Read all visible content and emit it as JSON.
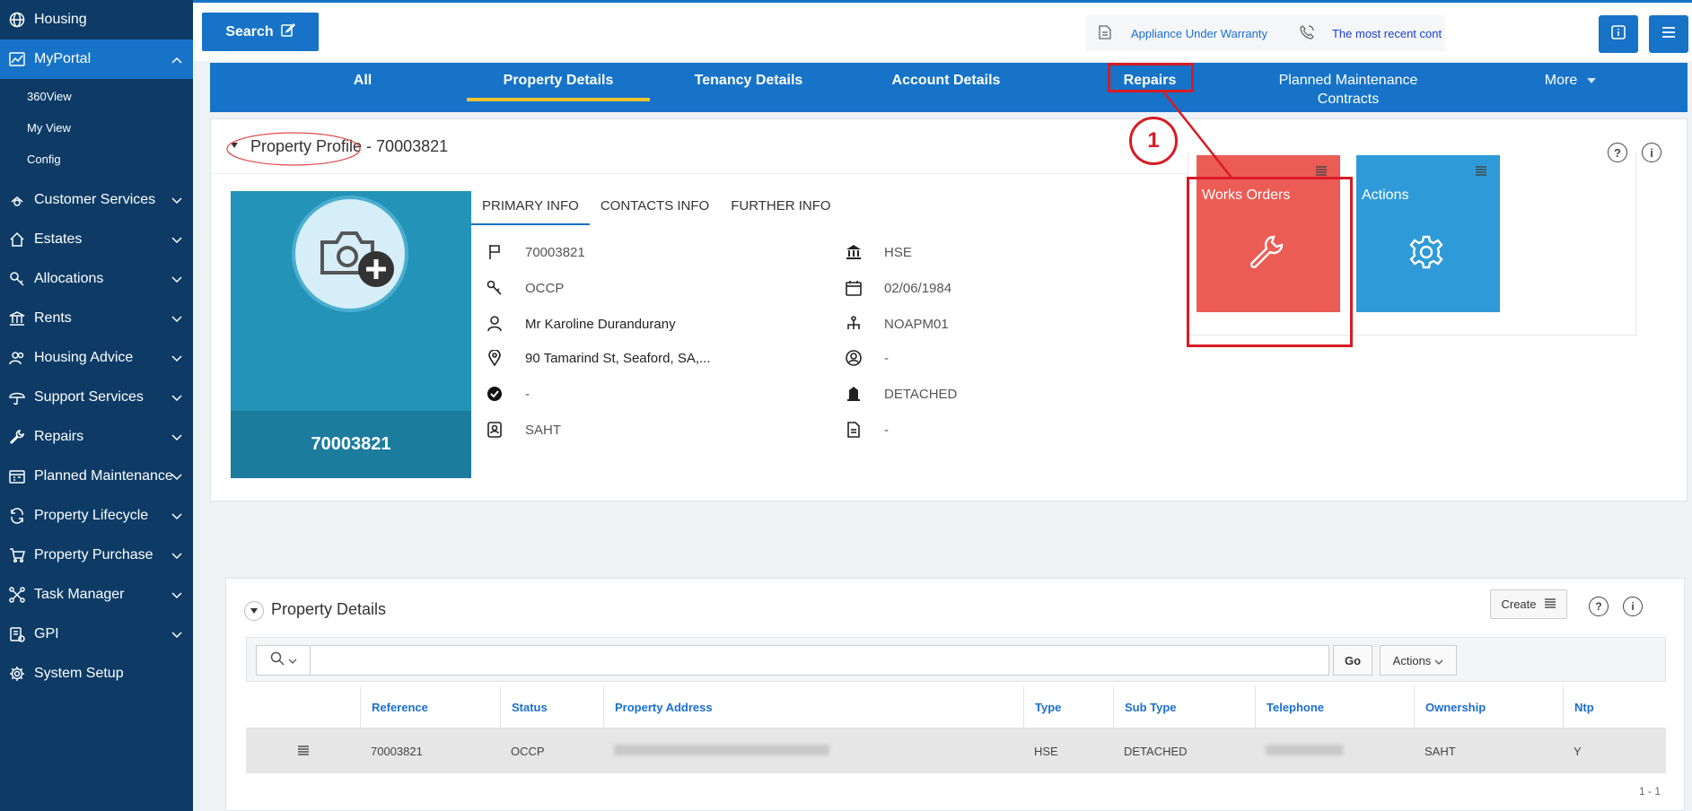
{
  "sidebar": {
    "items": [
      {
        "label": "Housing",
        "icon": "globe-icon",
        "chevron": false
      },
      {
        "label": "MyPortal",
        "icon": "portal-icon",
        "chevron": true,
        "active": true
      },
      {
        "label": "Customer Services",
        "icon": "customer-icon",
        "chevron": true
      },
      {
        "label": "Estates",
        "icon": "home-icon",
        "chevron": true
      },
      {
        "label": "Allocations",
        "icon": "key-icon",
        "chevron": true
      },
      {
        "label": "Rents",
        "icon": "bank-icon",
        "chevron": true
      },
      {
        "label": "Housing Advice",
        "icon": "users-icon",
        "chevron": true
      },
      {
        "label": "Support Services",
        "icon": "umbrella-icon",
        "chevron": true
      },
      {
        "label": "Repairs",
        "icon": "wrench-icon",
        "chevron": true
      },
      {
        "label": "Planned Maintenance",
        "icon": "calendar-icon",
        "chevron": true
      },
      {
        "label": "Property Lifecycle",
        "icon": "cycle-icon",
        "chevron": true
      },
      {
        "label": "Property Purchase",
        "icon": "cart-icon",
        "chevron": true
      },
      {
        "label": "Task Manager",
        "icon": "network-icon",
        "chevron": true
      },
      {
        "label": "GPI",
        "icon": "gpi-icon",
        "chevron": true
      },
      {
        "label": "System Setup",
        "icon": "gear-icon",
        "chevron": false
      }
    ],
    "subitems": [
      "360View",
      "My View",
      "Config"
    ]
  },
  "topbar": {
    "search_label": "Search",
    "ticker": [
      "Appliance Under Warranty",
      "The most recent cont"
    ]
  },
  "tabs": [
    "All",
    "Property Details",
    "Tenancy Details",
    "Account Details",
    "Repairs",
    "Planned Maintenance Contracts",
    "More"
  ],
  "profile": {
    "title": "Property Profile - 70003821",
    "photo_id": "70003821",
    "subtabs": [
      "PRIMARY INFO",
      "CONTACTS INFO",
      "FURTHER INFO"
    ],
    "left": [
      "70003821",
      "OCCP",
      "Mr Karoline Durandurany",
      "90 Tamarind St, Seaford, SA,...",
      "-",
      "SAHT"
    ],
    "right": [
      "HSE",
      "02/06/1984",
      "NOAPM01",
      "-",
      "DETACHED",
      "-"
    ]
  },
  "tiles": [
    {
      "label": "Works Orders",
      "color": "#eb5c55"
    },
    {
      "label": "Actions",
      "color": "#2f9ad8"
    }
  ],
  "annotation": {
    "step": "1",
    "color": "#d81b24"
  },
  "details": {
    "title": "Property Details",
    "create_label": "Create",
    "go_label": "Go",
    "actions_label": "Actions",
    "columns": [
      "Reference",
      "Status",
      "Property Address",
      "Type",
      "Sub Type",
      "Telephone",
      "Ownership",
      "Ntp"
    ],
    "row": [
      "70003821",
      "OCCP",
      "",
      "HSE",
      "DETACHED",
      "",
      "SAHT",
      "Y"
    ],
    "pager": "1 - 1"
  }
}
